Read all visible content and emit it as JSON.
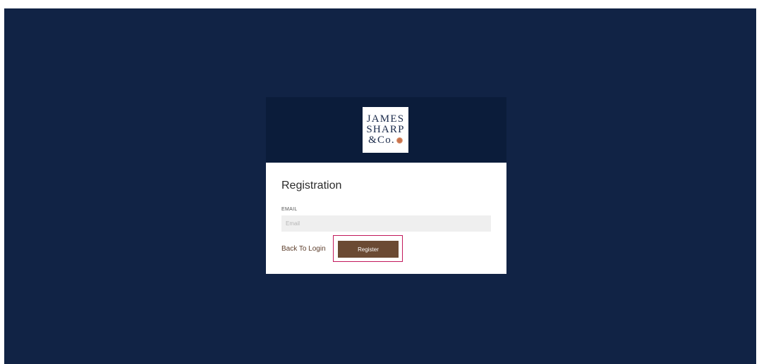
{
  "brand": {
    "logo_lines": [
      "JAMES",
      "SHARP",
      "&Co."
    ]
  },
  "form": {
    "title": "Registration",
    "email_label": "EMAIL",
    "email_placeholder": "Email",
    "email_value": "",
    "back_link": "Back To Login",
    "register_button": "Register"
  },
  "colors": {
    "background": "#112345",
    "header": "#0b1c3a",
    "button": "#6b4a33",
    "highlight_border": "#c2185b"
  }
}
